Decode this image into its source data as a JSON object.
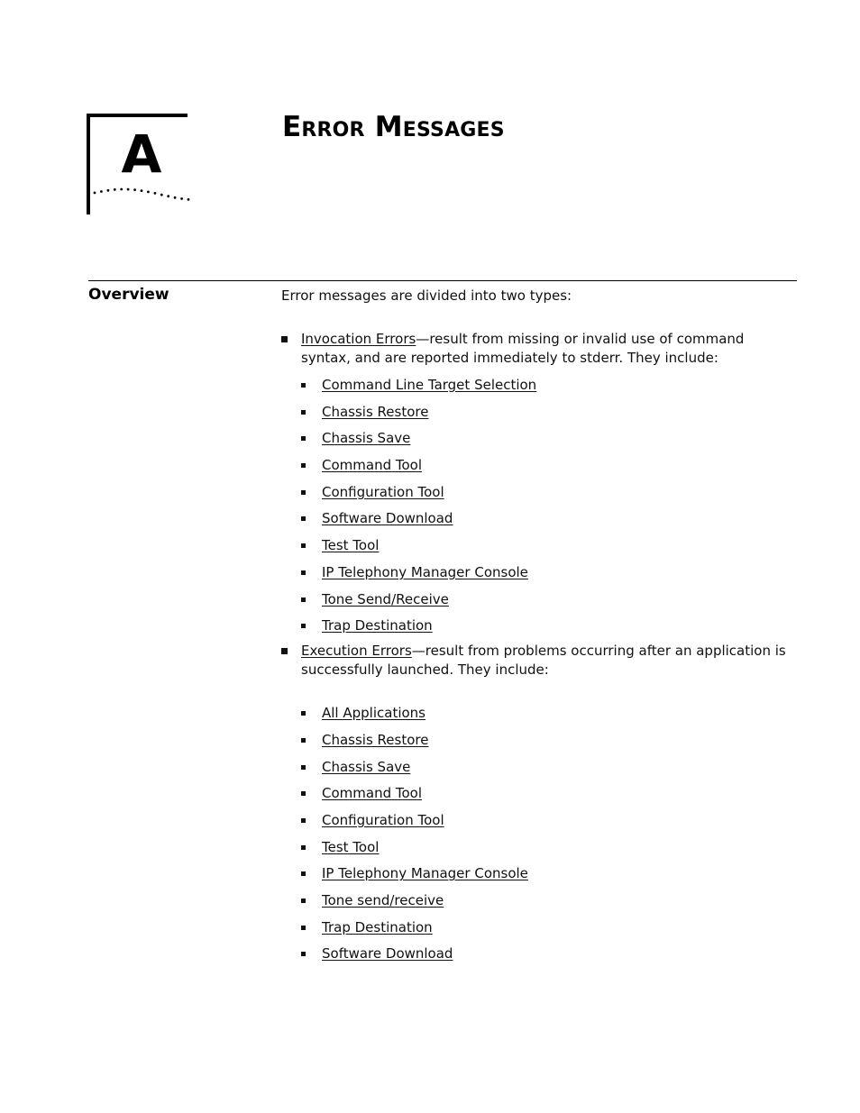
{
  "chapter": {
    "letter": "A",
    "title": "Error Messages"
  },
  "section": {
    "heading": "Overview",
    "intro": "Error messages are divided into two types:",
    "types": [
      {
        "link_label": "Invocation Errors",
        "description": "—result from missing or invalid use of command syntax, and are reported immediately to stderr. They include:",
        "items": [
          "Command Line Target Selection",
          "Chassis Restore",
          "Chassis Save",
          "Command Tool",
          "Configuration Tool",
          "Software Download",
          "Test Tool",
          "IP Telephony Manager Console",
          "Tone Send/Receive",
          "Trap Destination"
        ]
      },
      {
        "link_label": "Execution Errors",
        "description": "—result from problems occurring after an application is successfully launched. They include:",
        "items": [
          "All Applications",
          "Chassis Restore",
          "Chassis Save",
          "Command Tool",
          "Configuration Tool",
          "Test Tool",
          "IP Telephony Manager Console",
          "Tone send/receive",
          "Trap Destination",
          "Software Download"
        ]
      }
    ]
  }
}
